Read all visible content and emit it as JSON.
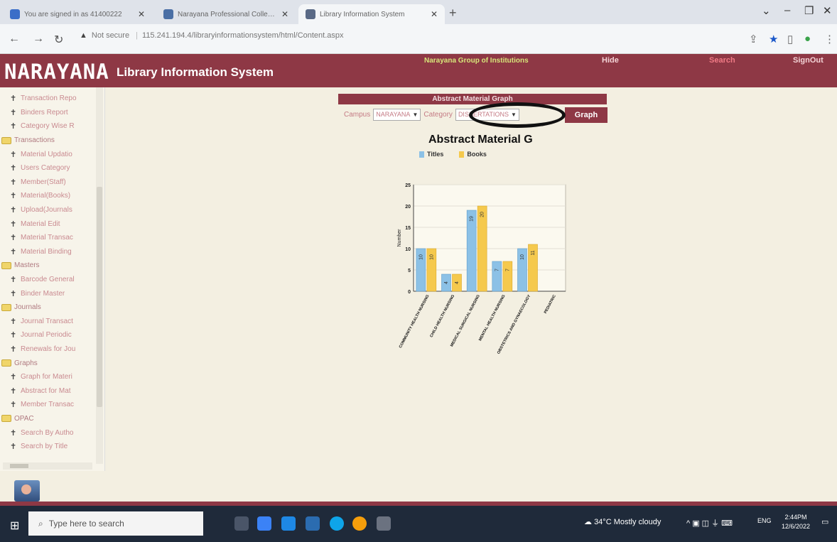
{
  "browser": {
    "tabs": [
      {
        "label": "You are signed in as 41400222",
        "favicon_color": "#3b6ec8"
      },
      {
        "label": "Narayana Professional Colleges",
        "favicon_color": "#4a6fa5"
      },
      {
        "label": "Library Information System",
        "favicon_color": "#5a6a86"
      }
    ],
    "new_tab": "+",
    "url_warning": "Not secure",
    "url": "115.241.194.4/libraryinformationsystem/html/Content.aspx"
  },
  "header": {
    "brand": "NARAYANA",
    "app_title": "Library Information System",
    "institution": "Narayana Group of Institutions",
    "hide": "Hide",
    "search": "Search",
    "signout": "SignOut",
    "color": "#8e3845"
  },
  "sidebar": {
    "nodes": [
      {
        "type": "leaf",
        "label": "Transaction Repo"
      },
      {
        "type": "leaf",
        "label": "Binders Report"
      },
      {
        "type": "leaf",
        "label": "Category Wise R"
      },
      {
        "type": "folder",
        "label": "Transactions"
      },
      {
        "type": "leaf",
        "label": "Material Updatio"
      },
      {
        "type": "leaf",
        "label": "Users Category"
      },
      {
        "type": "leaf",
        "label": "Member(Staff)"
      },
      {
        "type": "leaf",
        "label": "Material(Books)"
      },
      {
        "type": "leaf",
        "label": "Upload(Journals"
      },
      {
        "type": "leaf",
        "label": "Material Edit"
      },
      {
        "type": "leaf",
        "label": "Material Transac"
      },
      {
        "type": "leaf",
        "label": "Material Binding"
      },
      {
        "type": "folder",
        "label": "Masters"
      },
      {
        "type": "leaf",
        "label": "Barcode General"
      },
      {
        "type": "leaf",
        "label": "Binder Master"
      },
      {
        "type": "folder",
        "label": "Journals"
      },
      {
        "type": "leaf",
        "label": "Journal Transact"
      },
      {
        "type": "leaf",
        "label": "Journal Periodic"
      },
      {
        "type": "leaf",
        "label": "Renewals for Jou"
      },
      {
        "type": "folder",
        "label": "Graphs"
      },
      {
        "type": "leaf",
        "label": "Graph for Materi"
      },
      {
        "type": "leaf",
        "label": "Abstract for Mat"
      },
      {
        "type": "leaf",
        "label": "Member Transac"
      },
      {
        "type": "folder",
        "label": "OPAC"
      },
      {
        "type": "leaf",
        "label": "Search By Autho"
      },
      {
        "type": "leaf",
        "label": "Search by Title"
      }
    ]
  },
  "panel": {
    "heading": "Abstract Material Graph",
    "campus_label": "Campus",
    "campus_value": "NARAYANA",
    "category_label": "Category",
    "category_value": "DISSERTATIONS",
    "graph_button": "Graph"
  },
  "chart_data": {
    "type": "bar",
    "title": "Abstract Material G",
    "ylabel": "Number",
    "xlabel": "",
    "ylim": [
      0,
      25
    ],
    "yticks": [
      0,
      5,
      10,
      15,
      20,
      25
    ],
    "legend": "top",
    "categories": [
      "COMMUNITY HEALTH NURSING",
      "CHILD HEALTH NURSING",
      "MEDICAL SURGICAL NURSING",
      "MENTAL HEALTH NURSING",
      "OBSTETRICS AND GYNAECOLOGY",
      "PEDIATRIC"
    ],
    "series": [
      {
        "name": "Titles",
        "values": [
          10,
          4,
          19,
          7,
          10,
          0
        ],
        "color": "#8cc1e6"
      },
      {
        "name": "Books",
        "values": [
          10,
          4,
          20,
          7,
          11,
          0
        ],
        "color": "#f5c94d"
      }
    ]
  },
  "taskbar": {
    "search_placeholder": "Type here to search",
    "weather": "34°C  Mostly cloudy",
    "lang": "ENG",
    "time": "2:44PM",
    "date": "12/6/2022"
  }
}
